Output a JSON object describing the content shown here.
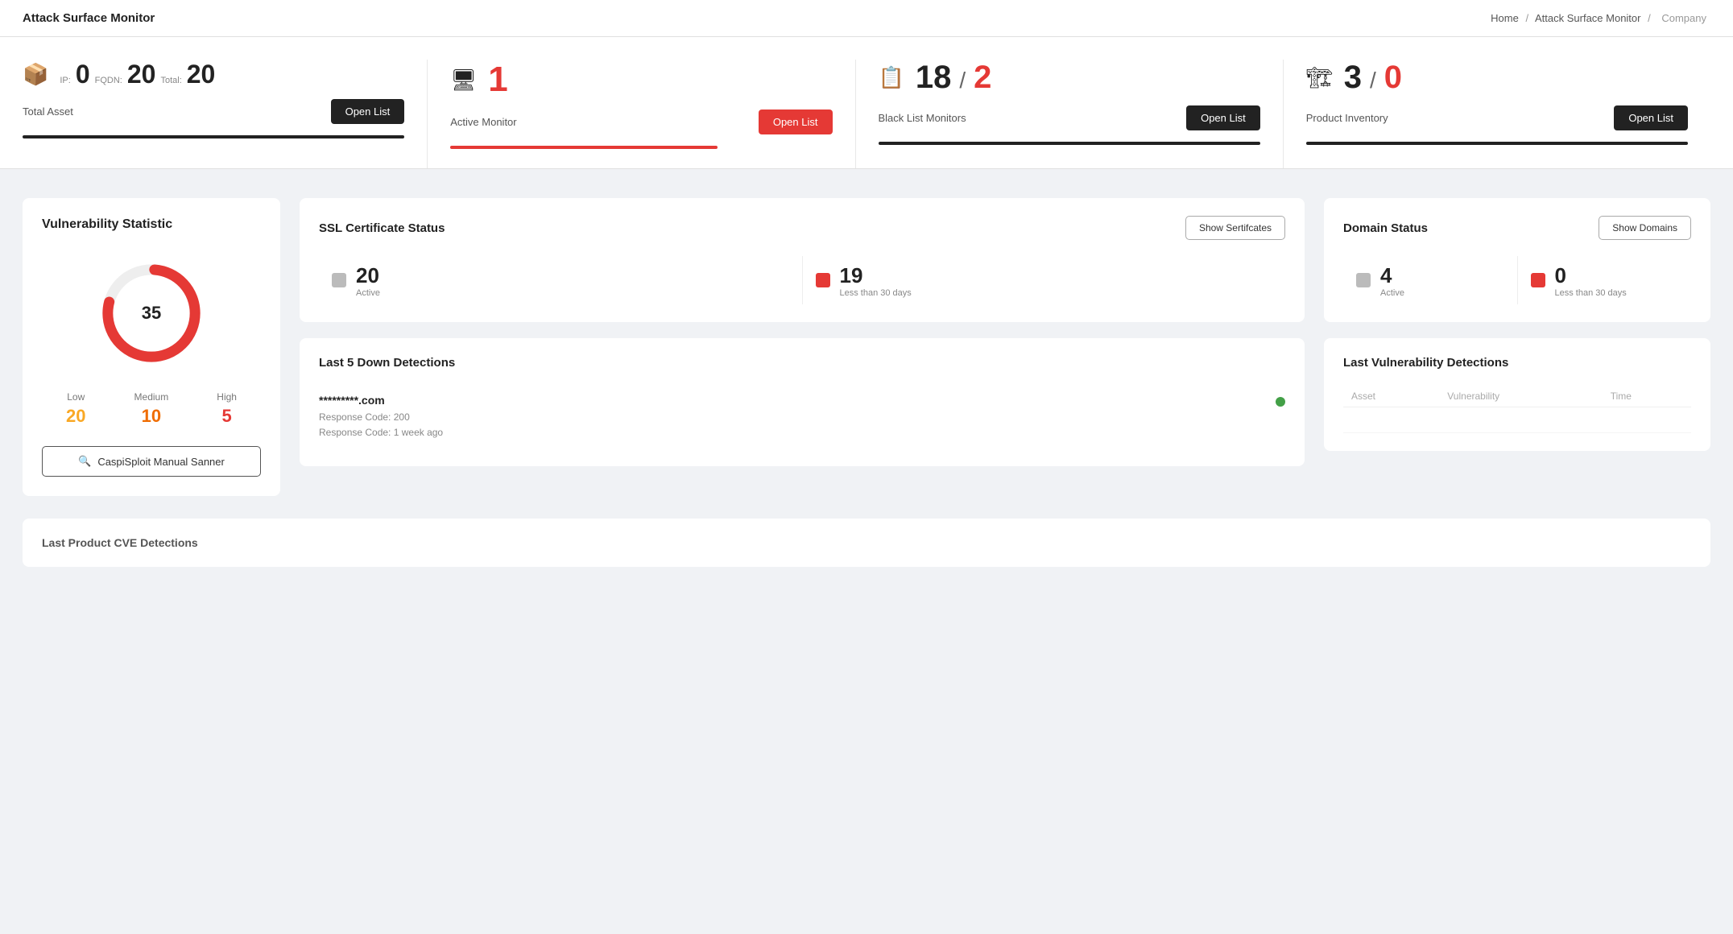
{
  "app": {
    "title": "Attack Surface Monitor",
    "breadcrumb": {
      "home": "Home",
      "monitor": "Attack Surface Monitor",
      "current": "Company"
    }
  },
  "summary_cards": [
    {
      "id": "total-asset",
      "icon": "📦",
      "ip_label": "IP:",
      "ip_value": "0",
      "fqdn_label": "FQDN:",
      "fqdn_value": "20",
      "total_label": "Total:",
      "total_value": "20",
      "label": "Total Asset",
      "button_label": "Open List",
      "button_style": "dark",
      "is_red": false
    },
    {
      "id": "active-monitor",
      "icon": "🖥",
      "main_value": "1",
      "label": "Active Monitor",
      "button_label": "Open List",
      "button_style": "red",
      "is_red": true
    },
    {
      "id": "blacklist-monitor",
      "icon": "📋",
      "main_value1": "18",
      "main_value2": "2",
      "label": "Black List Monitors",
      "button_label": "Open List",
      "button_style": "dark",
      "is_red": false
    },
    {
      "id": "product-inventory",
      "icon": "🏗",
      "main_value1": "3",
      "main_value2": "0",
      "label": "Product Inventory",
      "button_label": "Open List",
      "button_style": "dark",
      "is_red": false
    }
  ],
  "vulnerability_statistic": {
    "title": "Vulnerability Statistic",
    "total": "35",
    "low": {
      "label": "Low",
      "value": "20"
    },
    "medium": {
      "label": "Medium",
      "value": "10"
    },
    "high": {
      "label": "High",
      "value": "5"
    },
    "scanner_button": "CaspiSploit Manual Sanner"
  },
  "ssl_certificate": {
    "title": "SSL Certificate Status",
    "button_label": "Show Sertifcates",
    "active": {
      "value": "20",
      "label": "Active"
    },
    "expiring": {
      "value": "19",
      "label": "Less than 30 days"
    }
  },
  "down_detections": {
    "title": "Last 5 Down Detections",
    "items": [
      {
        "domain": "*********.com",
        "response_code": "Response Code: 200",
        "time": "Response Code: 1 week ago"
      }
    ]
  },
  "domain_status": {
    "title": "Domain Status",
    "button_label": "Show Domains",
    "active": {
      "value": "4",
      "label": "Active"
    },
    "expiring": {
      "value": "0",
      "label": "Less than 30 days"
    }
  },
  "last_vuln_detections": {
    "title": "Last Vulnerability Detections",
    "columns": [
      "Asset",
      "Vulnerability",
      "Time"
    ]
  },
  "bottom": {
    "title": "Last Product CVE Detections"
  }
}
